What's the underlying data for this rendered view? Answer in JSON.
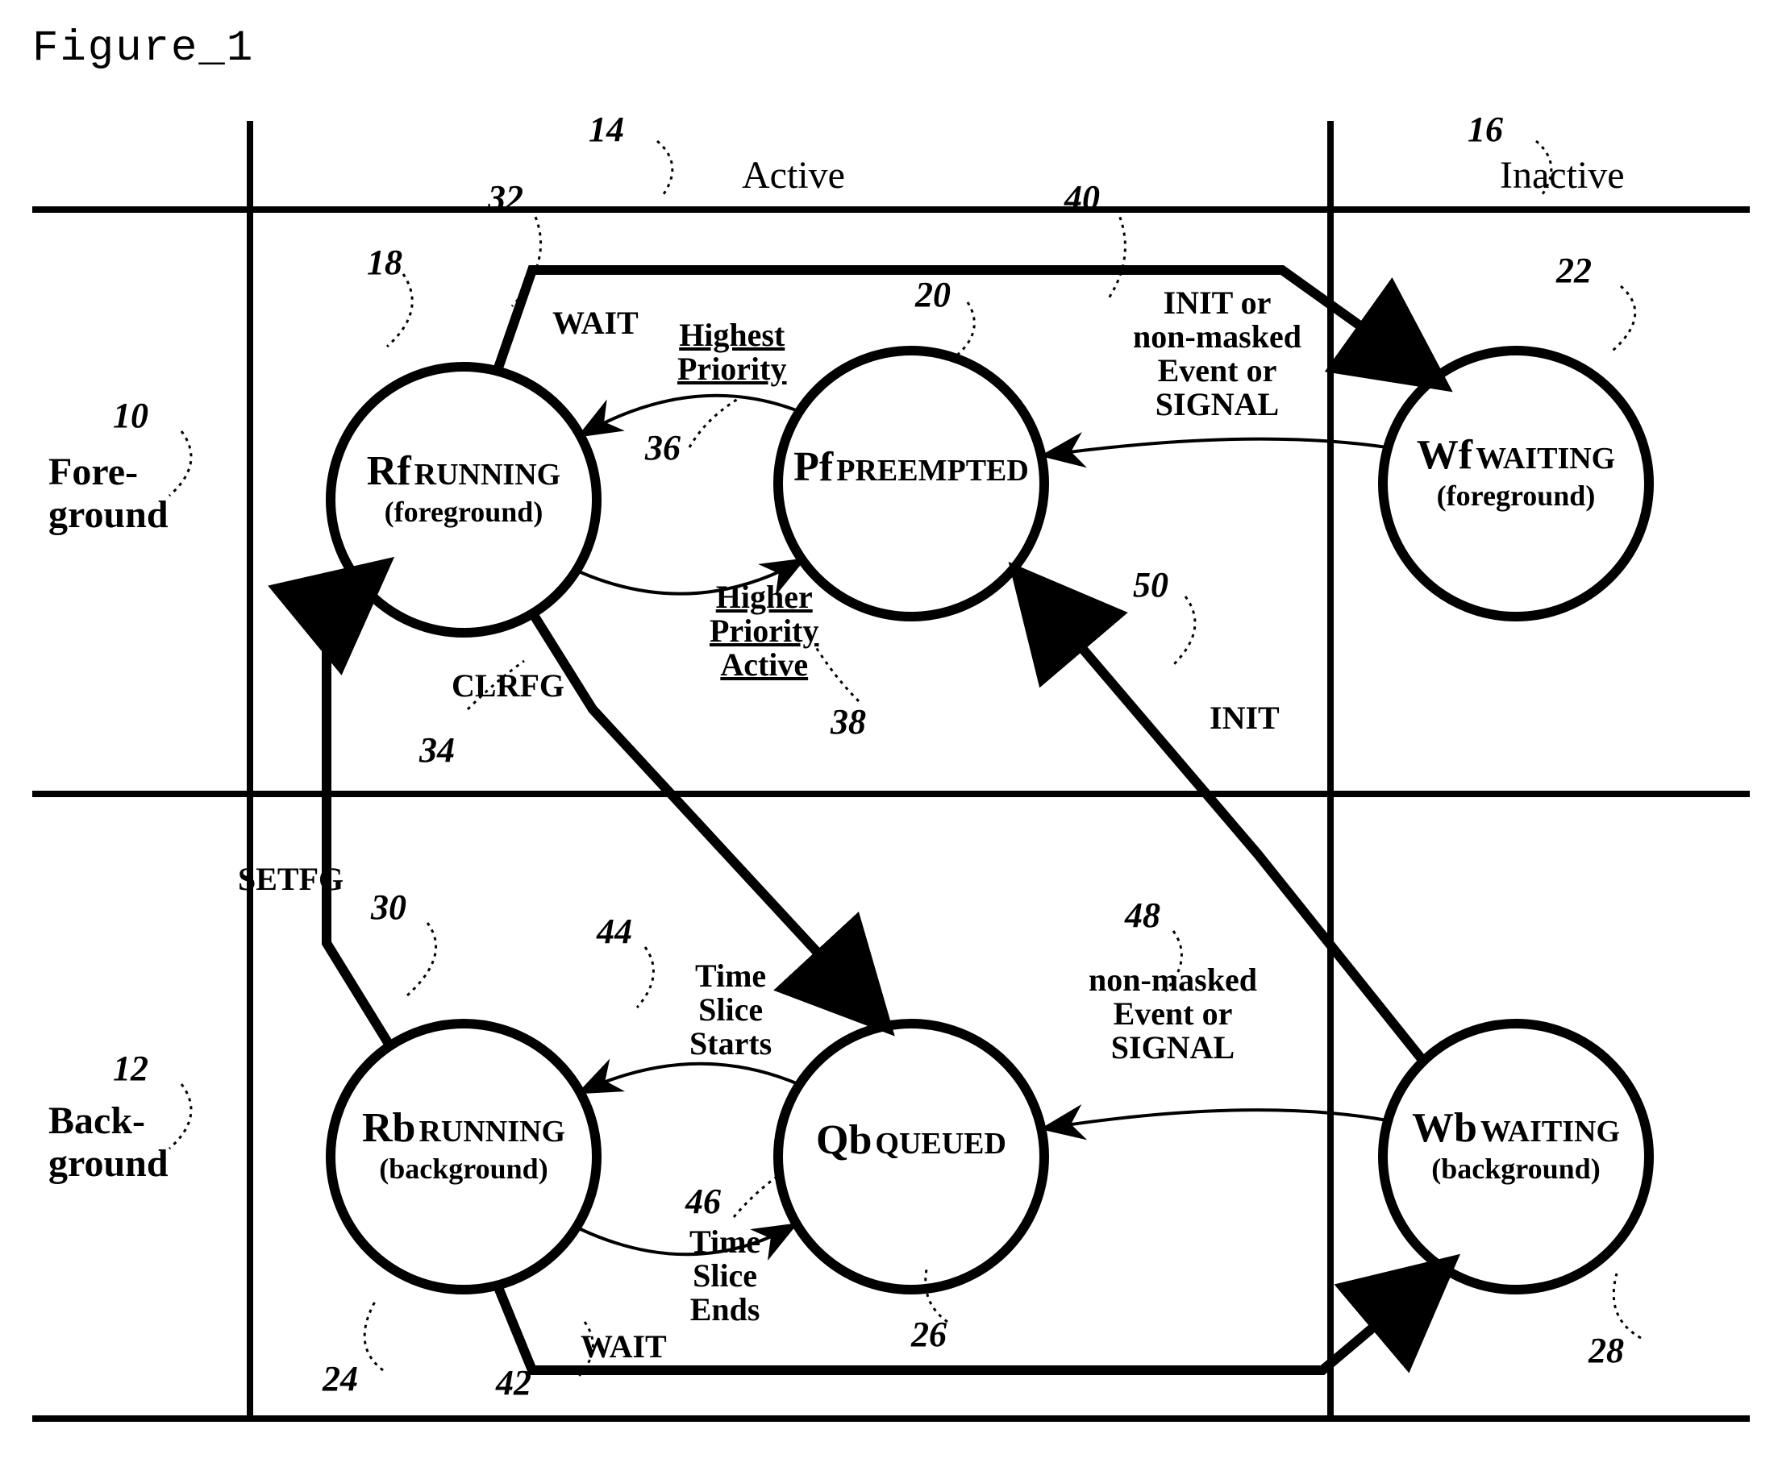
{
  "figure_title": "Figure_1",
  "columns": {
    "active": "Active",
    "inactive": "Inactive"
  },
  "rows": {
    "foreground_l1": "Fore-",
    "foreground_l2": "ground",
    "background_l1": "Back-",
    "background_l2": "ground"
  },
  "states": {
    "Rf": {
      "sym": "Rf",
      "name": "RUNNING",
      "paren": "(foreground)"
    },
    "Pf": {
      "sym": "Pf",
      "name": "PREEMPTED",
      "paren": ""
    },
    "Wf": {
      "sym": "Wf",
      "name": "WAITING",
      "paren": "(foreground)"
    },
    "Rb": {
      "sym": "Rb",
      "name": "RUNNING",
      "paren": "(background)"
    },
    "Qb": {
      "sym": "Qb",
      "name": "QUEUED",
      "paren": ""
    },
    "Wb": {
      "sym": "Wb",
      "name": "WAITING",
      "paren": "(background)"
    }
  },
  "edges": {
    "setfg": "SETFG",
    "wait_top": "WAIT",
    "clrfg": "CLRFG",
    "highest_priority": "Highest\nPriority",
    "higher_priority_active": "Higher\nPriority\nActive",
    "init_event_signal": "INIT or\nnon-masked\nEvent or\nSIGNAL",
    "wait_bottom": "WAIT",
    "time_slice_starts": "Time\nSlice\nStarts",
    "time_slice_ends": "Time\nSlice\nEnds",
    "nonmasked_event_signal": "non-masked\nEvent or\nSIGNAL",
    "init": "INIT"
  },
  "refs": {
    "r10": "10",
    "r12": "12",
    "r14": "14",
    "r16": "16",
    "r18": "18",
    "r20": "20",
    "r22": "22",
    "r24": "24",
    "r26": "26",
    "r28": "28",
    "r30": "30",
    "r32": "32",
    "r34": "34",
    "r36": "36",
    "r38": "38",
    "r40": "40",
    "r42": "42",
    "r44": "44",
    "r46": "46",
    "r48": "48",
    "r50": "50"
  }
}
